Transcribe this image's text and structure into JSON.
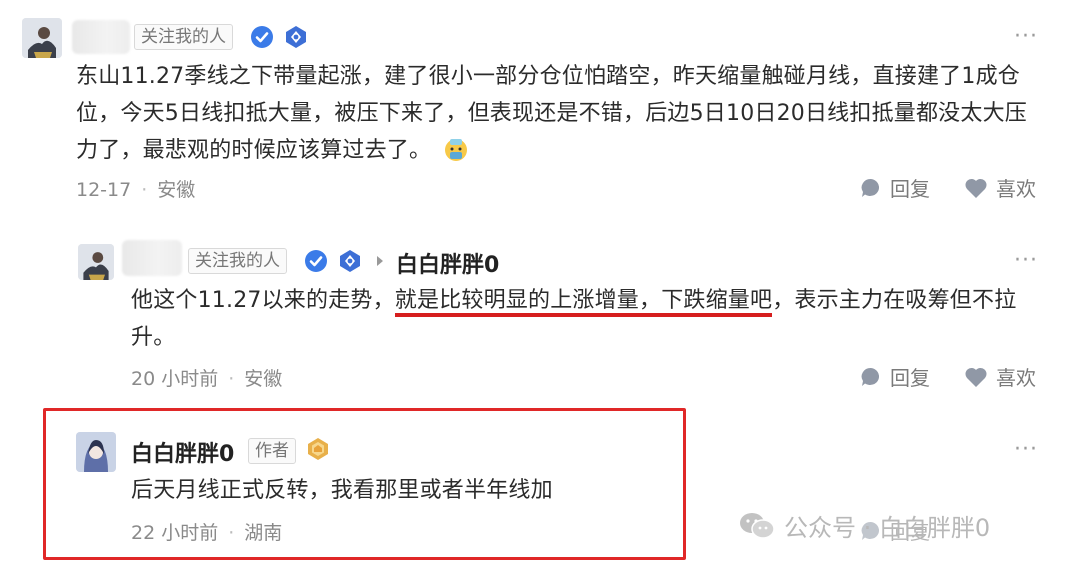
{
  "comment1": {
    "follow_tag": "关注我的人",
    "text": "东山11.27季线之下带量起涨，建了很小一部分仓位怕踏空，昨天缩量触碰月线，直接建了1成仓位，今天5日线扣抵大量，被压下来了，但表现还是不错，后边5日10日20日线扣抵量都没太大压力了，最悲观的时候应该算过去了。",
    "date": "12-17",
    "location": "安徽",
    "reply_label": "回复",
    "like_label": "喜欢",
    "more": "···"
  },
  "comment2": {
    "follow_tag": "关注我的人",
    "reply_to": "白白胖胖0",
    "text_part1": "他这个11.27以来的走势，",
    "text_highlight": "就是比较明显的上涨增量，下跌缩量吧",
    "text_part2": "，表示主力在吸筹但不拉升。",
    "date": "20 小时前",
    "location": "安徽",
    "reply_label": "回复",
    "like_label": "喜欢",
    "more": "···"
  },
  "comment3": {
    "name": "白白胖胖0",
    "author_tag": "作者",
    "text": "后天月线正式反转，我看那里或者半年线加",
    "date": "22 小时前",
    "location": "湖南",
    "reply_label": "回复",
    "more": "···"
  },
  "watermark": {
    "text": "公众号 · 白白胖胖0"
  },
  "colors": {
    "highlight_red": "#d61e1e",
    "box_red": "#e02828",
    "verified_blue": "#3b7be8"
  }
}
